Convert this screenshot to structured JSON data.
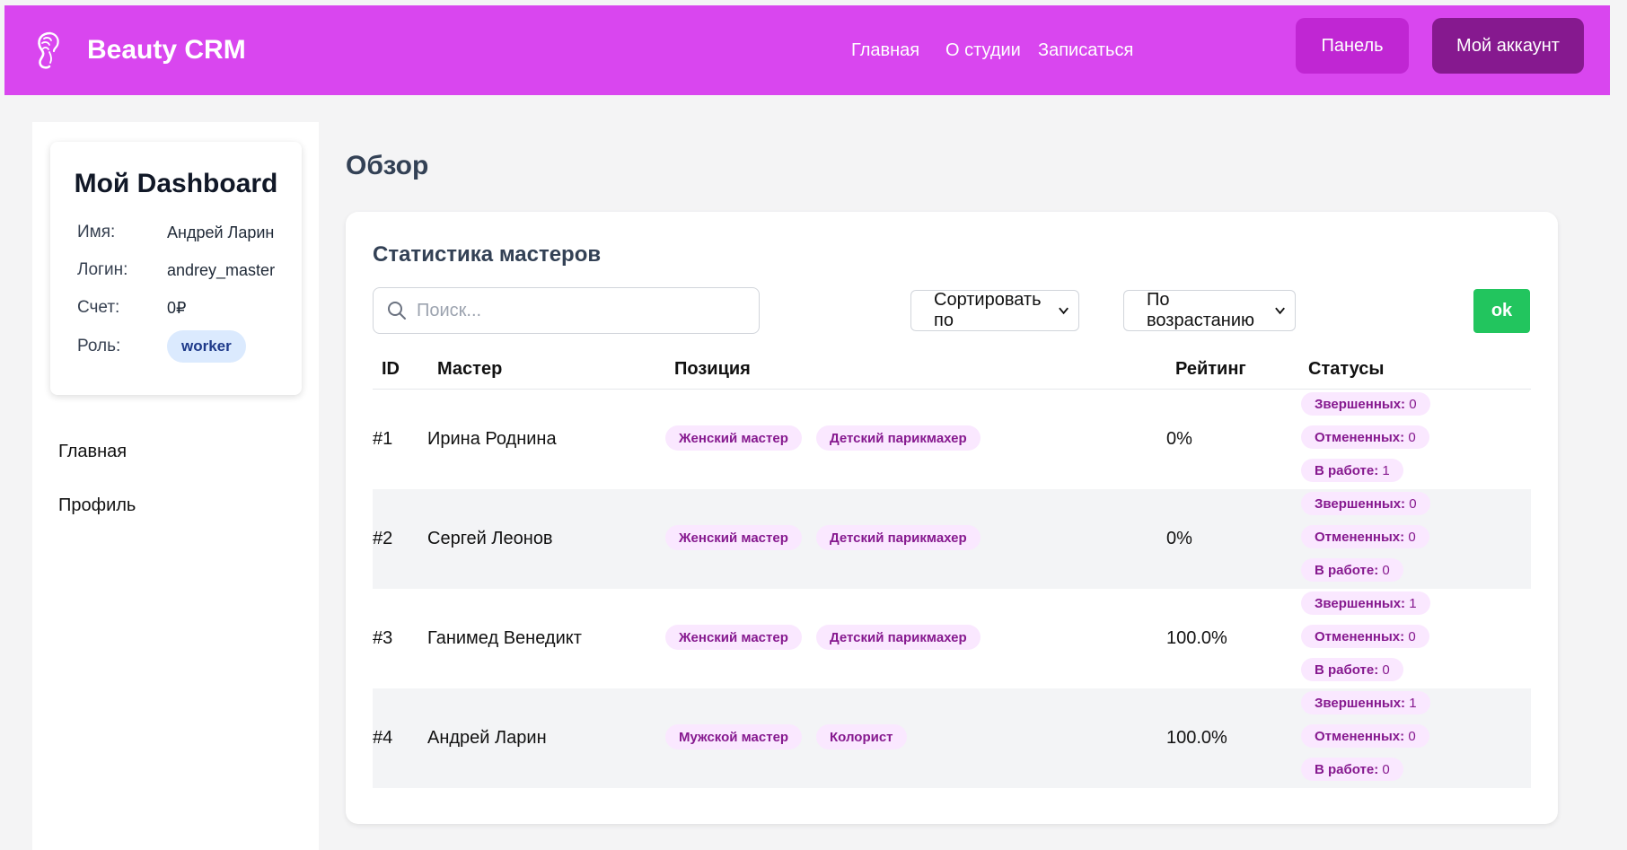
{
  "header": {
    "brand": "Beauty CRM",
    "logo_icon": "woman-silhouette-icon",
    "nav": {
      "home": "Главная",
      "about": "О студии",
      "book": "Записаться",
      "panel": "Панель",
      "account": "Мой аккаунт"
    },
    "colors": {
      "bar": "#d946ef",
      "panel_button": "#c026d3",
      "account_button": "#86198f"
    }
  },
  "sidebar": {
    "profile": {
      "title": "Мой Dashboard",
      "name_label": "Имя:",
      "name_value": "Андрей Ларин",
      "login_label": "Логин:",
      "login_value": "andrey_master",
      "balance_label": "Счет:",
      "balance_value": "0₽",
      "role_label": "Роль:",
      "role_value": "worker"
    },
    "links": {
      "home": "Главная",
      "profile": "Профиль"
    }
  },
  "main": {
    "title": "Обзор",
    "stats": {
      "title": "Статистика мастеров",
      "search_placeholder": "Поиск...",
      "sort_by": "Сортировать по",
      "order": "По возрастанию",
      "ok": "ok",
      "columns": {
        "id": "ID",
        "master": "Мастер",
        "position": "Позиция",
        "rating": "Рейтинг",
        "statuses": "Статусы"
      },
      "status_labels": {
        "done": "Звершенных",
        "cancelled": "Отмененных",
        "in_work": "В работе"
      },
      "rows": [
        {
          "id": "#1",
          "name": "Ирина Роднина",
          "pos1": "Женский мастер",
          "pos2": "Детский парикмахер",
          "rating": "0%",
          "done": "0",
          "cancelled": "0",
          "in_work": "1"
        },
        {
          "id": "#2",
          "name": "Сергей Леонов",
          "pos1": "Женский мастер",
          "pos2": "Детский парикмахер",
          "rating": "0%",
          "done": "0",
          "cancelled": "0",
          "in_work": "0"
        },
        {
          "id": "#3",
          "name": "Ганимед Венедикт",
          "pos1": "Женский мастер",
          "pos2": "Детский парикмахер",
          "rating": "100.0%",
          "done": "1",
          "cancelled": "0",
          "in_work": "0"
        },
        {
          "id": "#4",
          "name": "Андрей Ларин",
          "pos1": "Мужской мастер",
          "pos2": "Колорист",
          "rating": "100.0%",
          "done": "1",
          "cancelled": "0",
          "in_work": "0"
        }
      ]
    }
  }
}
